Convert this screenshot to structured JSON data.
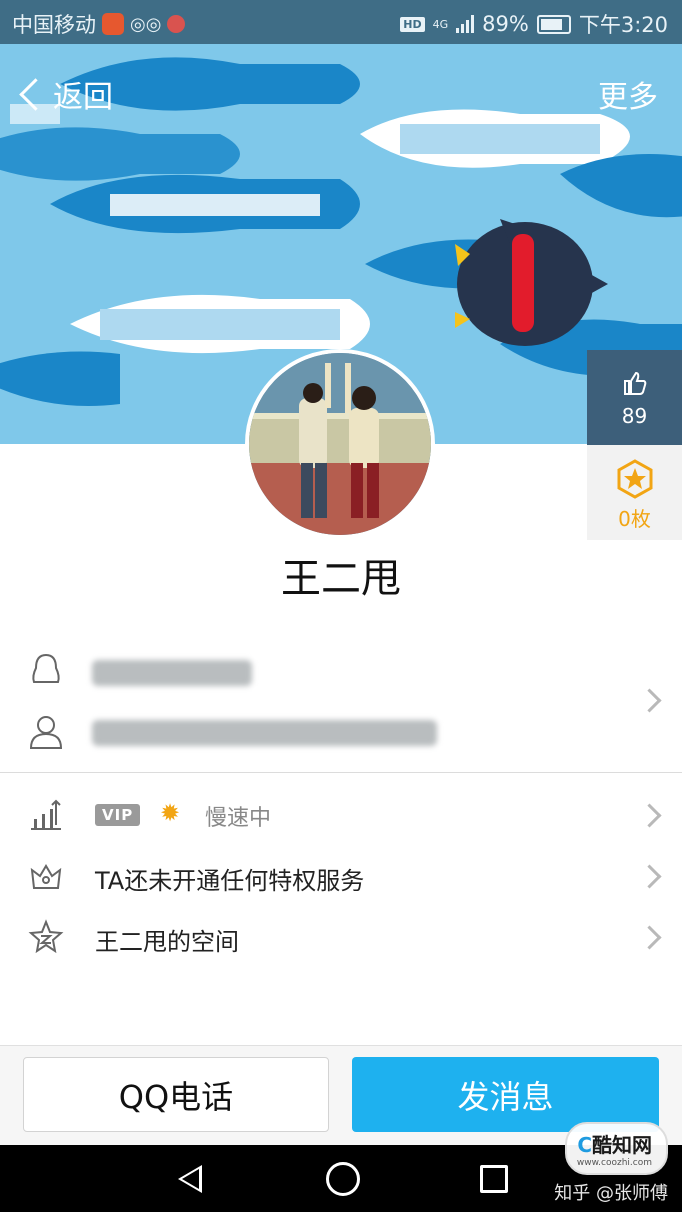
{
  "status_bar": {
    "carrier": "中国移动",
    "network": "4G",
    "hd": "HD",
    "battery": "89%",
    "time": "下午3:20"
  },
  "header": {
    "back_label": "返回",
    "more_label": "更多"
  },
  "stats": {
    "likes": "89",
    "coins": "0枚"
  },
  "profile": {
    "name": "王二甩"
  },
  "menu": {
    "vip_badge": "VIP",
    "speed_label": "慢速中",
    "privilege_label": "TA还未开通任何特权服务",
    "space_label": "王二甩的空间"
  },
  "actions": {
    "call_label": "QQ电话",
    "message_label": "发消息"
  },
  "watermark": {
    "logo_prefix": "C",
    "logo_text": "酷知网",
    "logo_sub": "www.coozhi.com",
    "credit": "知乎 @张师傅"
  },
  "colors": {
    "accent": "#1eb1ef",
    "banner": "#7fc8ea",
    "status_bar": "#3f6d86",
    "gold": "#f2a514"
  }
}
